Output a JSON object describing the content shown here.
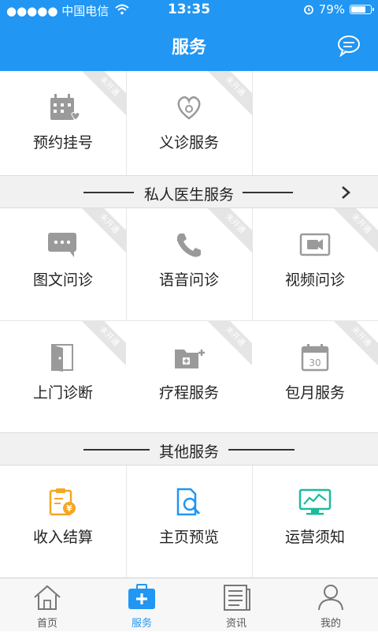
{
  "status": {
    "carrier": "●●●●● 中国电信",
    "time": "13:35",
    "battery_text": "79%",
    "battery_level": 0.79
  },
  "header": {
    "title": "服务",
    "chat_icon": "chat-bubble-icon"
  },
  "ribbon_text": "未开通",
  "top_row": [
    {
      "label": "预约挂号",
      "icon": "calendar-heart-icon",
      "status": "未开通"
    },
    {
      "label": "义诊服务",
      "icon": "hand-heart-icon",
      "status": "未开通"
    }
  ],
  "private_doctor": {
    "title": "私人医生服务",
    "rows": [
      [
        {
          "label": "图文问诊",
          "icon": "chat-text-icon",
          "status": "未开通"
        },
        {
          "label": "语音问诊",
          "icon": "phone-icon",
          "status": "未开通"
        },
        {
          "label": "视频问诊",
          "icon": "video-camera-icon",
          "status": "未开通"
        }
      ],
      [
        {
          "label": "上门诊断",
          "icon": "door-icon",
          "status": "未开通"
        },
        {
          "label": "疗程服务",
          "icon": "medical-folder-icon",
          "status": "未开通"
        },
        {
          "label": "包月服务",
          "icon": "calendar-30-icon",
          "status": "未开通"
        }
      ]
    ]
  },
  "other": {
    "title": "其他服务",
    "items": [
      {
        "label": "收入结算",
        "icon": "income-clipboard-icon",
        "color": "#F5A623"
      },
      {
        "label": "主页预览",
        "icon": "document-search-icon",
        "color": "#2196F3"
      },
      {
        "label": "运营须知",
        "icon": "monitor-chart-icon",
        "color": "#1ABC9C"
      }
    ]
  },
  "tabs": [
    {
      "label": "首页",
      "icon": "home-icon",
      "active": false
    },
    {
      "label": "服务",
      "icon": "medical-kit-icon",
      "active": true
    },
    {
      "label": "资讯",
      "icon": "newspaper-icon",
      "active": false
    },
    {
      "label": "我的",
      "icon": "user-icon",
      "active": false
    }
  ],
  "colors": {
    "brand": "#2196F3",
    "icon_gray": "#9a9a9a",
    "ribbon": "#e5e5e5",
    "band_bg": "#f1f1f1"
  }
}
